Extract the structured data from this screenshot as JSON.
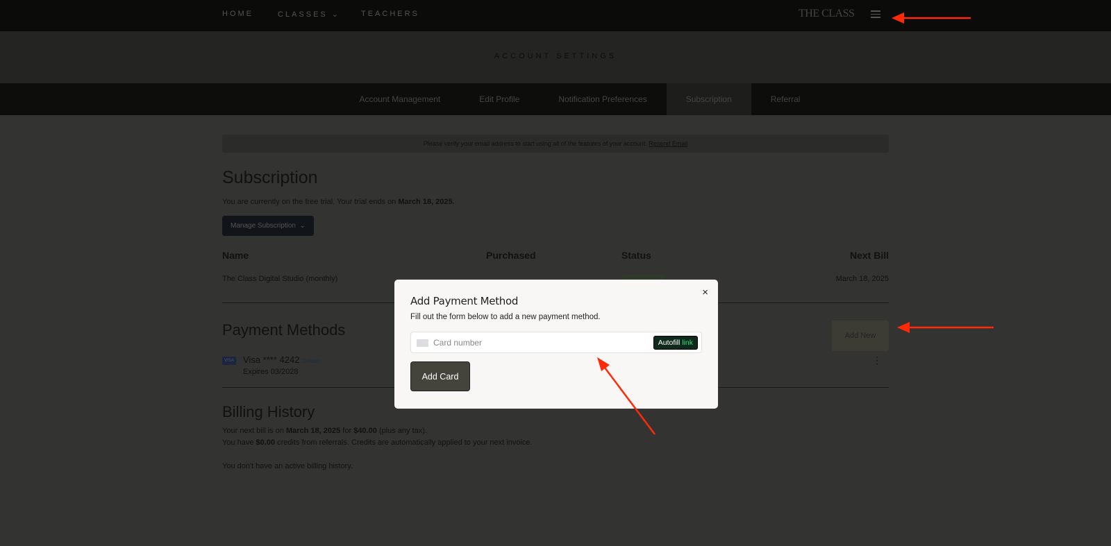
{
  "nav": {
    "items": [
      "HOME",
      "CLASSES ⌄",
      "TEACHERS"
    ],
    "logo": "THE CLASS",
    "menu_icon": "hamburger-icon"
  },
  "header": {
    "title": "ACCOUNT SETTINGS"
  },
  "tabs": [
    "Account Management",
    "Edit Profile",
    "Notification Preferences",
    "Subscription",
    "Referral"
  ],
  "active_tab": "Subscription",
  "banner": {
    "text": "Please verify your email address to start using all of the features of your account.",
    "link": "Resend Email"
  },
  "subscription": {
    "title": "Subscription",
    "trial_text": "You are currently on the free trial. Your trial ends on",
    "trial_date": "March 18, 2025.",
    "manage_label": "Manage Subscription",
    "columns": [
      "Name",
      "Purchased",
      "Status",
      "Next Bill"
    ],
    "row": {
      "name": "The Class Digital Studio (monthly)",
      "purchased": "",
      "next_bill": "March 18, 2025"
    }
  },
  "payment": {
    "title": "Payment Methods",
    "add_new": "Add New",
    "card": {
      "brand": "VISA",
      "label": "Visa **** 4242",
      "badge": "Default",
      "expires": "Expires 03/2028"
    }
  },
  "billing": {
    "title": "Billing History",
    "l1a": "Your next bill is on",
    "l1b": "March 18, 2025",
    "l1c": "for",
    "l1d": "$40.00",
    "l1e": "(plus any tax).",
    "l2a": "You have",
    "l2b": "$0.00",
    "l2c": "credits from referrals. Credits are automatically applied to your next invoice.",
    "l3": "You don't have an active billing history."
  },
  "modal": {
    "title": "Add Payment Method",
    "subtitle": "Fill out the form below to add a new payment method.",
    "close": "×",
    "card_placeholder": "Card number",
    "autofill": "Autofill",
    "autofill_brand": "link",
    "submit": "Add Card"
  },
  "colors": {
    "annotation_arrow": "#ff2a0a",
    "autofill_green": "#33dd77"
  }
}
